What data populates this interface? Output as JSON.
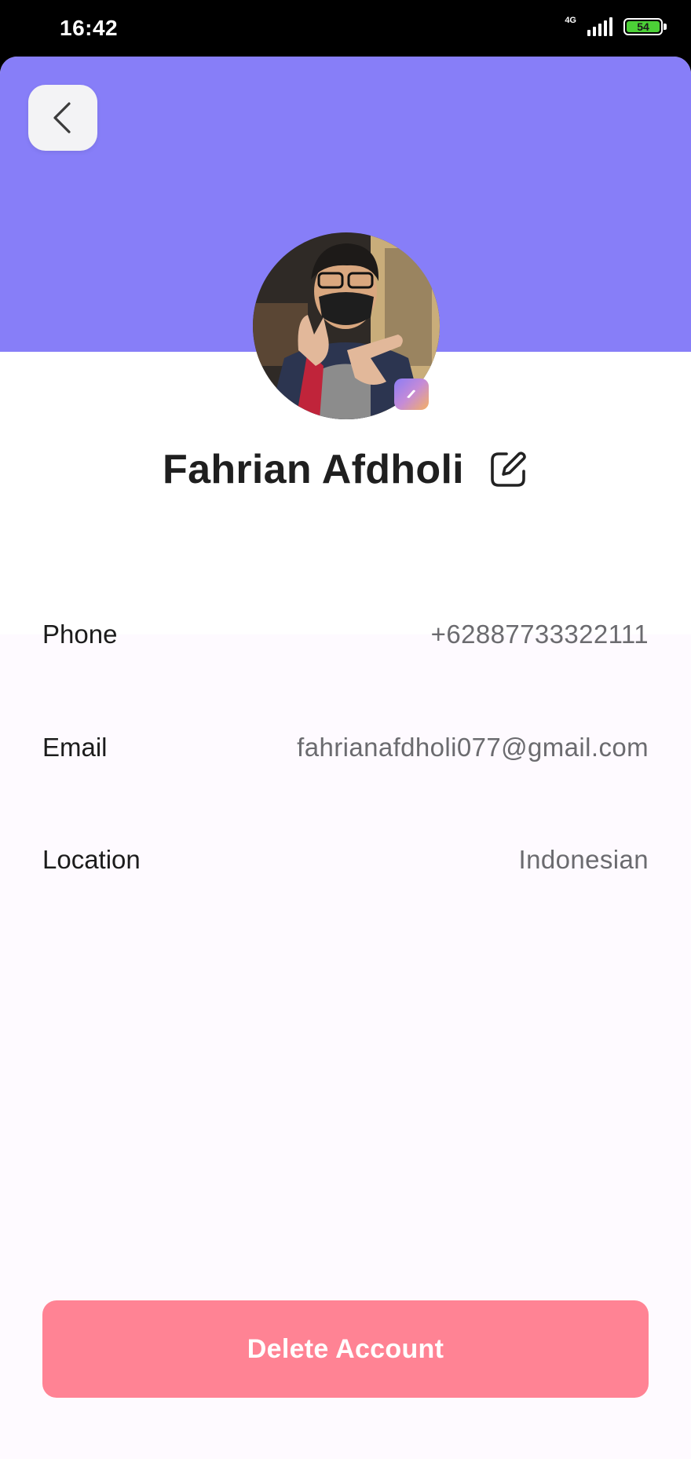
{
  "status_bar": {
    "time": "16:42",
    "network": "4G",
    "battery_level": "54",
    "battery_color": "#4cd137"
  },
  "header": {
    "back_icon": "chevron-left-icon",
    "accent_color": "#877ef8"
  },
  "profile": {
    "name": "Fahrian Afdholi",
    "edit_icon": "edit-icon",
    "camera_icon": "camera-icon"
  },
  "details": [
    {
      "label": "Phone",
      "value": "+62887733322111"
    },
    {
      "label": "Email",
      "value": "fahrianafdholi077@gmail.com"
    },
    {
      "label": "Location",
      "value": "Indonesian"
    }
  ],
  "actions": {
    "delete_label": "Delete Account",
    "delete_color": "#ff8394"
  }
}
